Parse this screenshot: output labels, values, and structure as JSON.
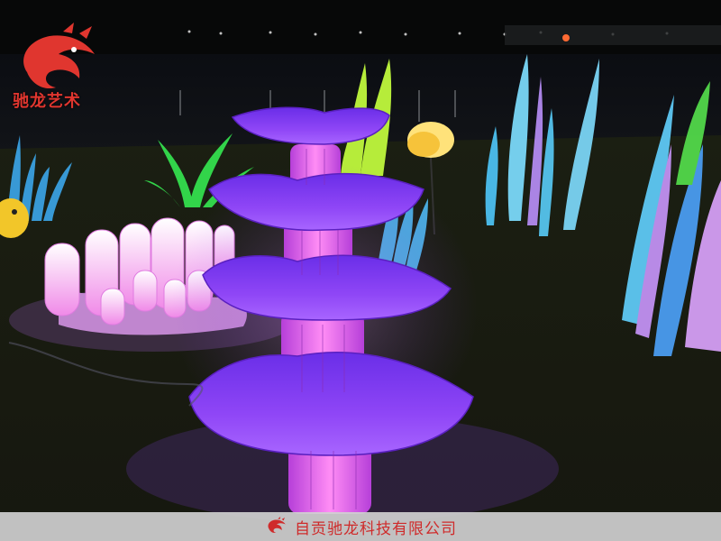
{
  "watermark": {
    "brand_text": "驰龙艺术",
    "icon": "dragon-logo-icon",
    "color": "#e0362f"
  },
  "footer": {
    "company_name": "自贡驰龙科技有限公司",
    "icon": "dragon-logo-icon",
    "color": "#cf2b2b"
  },
  "colors": {
    "flower_lantern": "#8a3df0",
    "flower_stem": "#e06bf0",
    "coral": "#f4a8f0",
    "seaweed_blue": "#4aa8e8",
    "grass_green": "#3ad84a",
    "ground": "#1a1d12"
  }
}
